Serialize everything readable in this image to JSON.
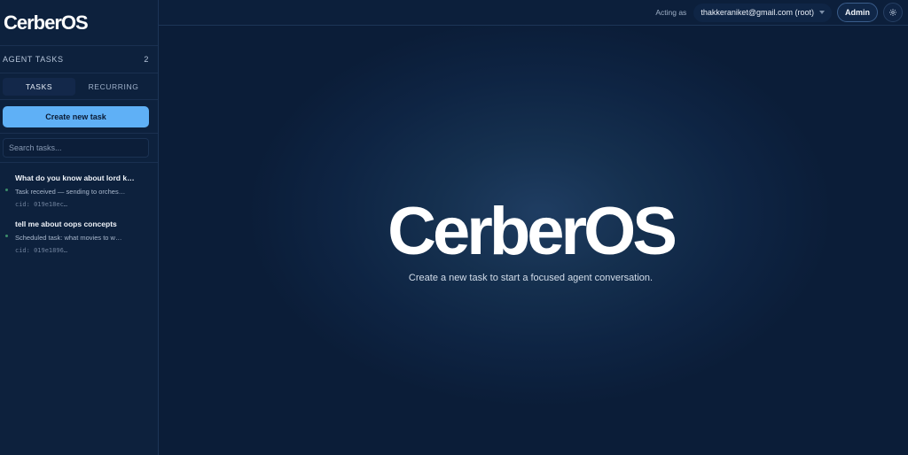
{
  "app": {
    "brand": "CerberOS"
  },
  "sidebar": {
    "section_title": "AGENT TASKS",
    "task_count": "2",
    "tabs": [
      {
        "label": "TASKS",
        "active": true
      },
      {
        "label": "RECURRING",
        "active": false
      }
    ],
    "create_button": "Create new task",
    "search_placeholder": "Search tasks...",
    "tasks": [
      {
        "title": "What do you know about lord k…",
        "subtitle": "Task received — sending to orches…",
        "cid": "cid: 019e18ec…",
        "status_color": "#3c8d6a"
      },
      {
        "title": "tell me about oops concepts",
        "subtitle": "Scheduled task: what movies to w…",
        "cid": "cid: 019e1896…",
        "status_color": "#3c8d6a"
      }
    ]
  },
  "topbar": {
    "acting_as_label": "Acting as",
    "user": "thakkeraniket@gmail.com (root)",
    "admin_button": "Admin",
    "settings_icon": "gear-icon"
  },
  "hero": {
    "logo": "CerberOS",
    "subtitle": "Create a new task to start a focused agent conversation."
  },
  "colors": {
    "accent": "#5fb0f6",
    "background": "#0b1d38"
  }
}
